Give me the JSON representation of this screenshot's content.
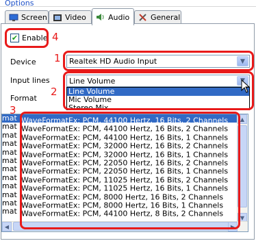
{
  "group_title": "Options",
  "tabs": [
    {
      "label": "Screen",
      "icon": "monitor-icon"
    },
    {
      "label": "Video",
      "icon": "film-icon"
    },
    {
      "label": "Audio",
      "icon": "speaker-icon",
      "active": true
    },
    {
      "label": "General",
      "icon": "tools-icon"
    }
  ],
  "enable_label": "Enable",
  "enable_checked": true,
  "device_label": "Device",
  "device_value": "Realtek HD Audio Input",
  "input_lines_label": "Input lines",
  "input_lines_value": "Line Volume",
  "input_lines_options": [
    "Line Volume",
    "Mic Volume",
    "Stereo Mix"
  ],
  "format_label": "Format",
  "callouts": {
    "n1": "1",
    "n2": "2",
    "n3": "3",
    "n4": "4"
  },
  "format_list": [
    "WaveFormatEx: PCM, 44100 Hertz, 16 Bits, 2 Channels",
    "WaveFormatEx: PCM, 44100 Hertz, 16 Bits, 2 Channels",
    "WaveFormatEx: PCM, 44100 Hertz, 16 Bits, 1 Channels",
    "WaveFormatEx: PCM, 32000 Hertz, 16 Bits, 2 Channels",
    "WaveFormatEx: PCM, 32000 Hertz, 16 Bits, 1 Channels",
    "WaveFormatEx: PCM, 22050 Hertz, 16 Bits, 2 Channels",
    "WaveFormatEx: PCM, 22050 Hertz, 16 Bits, 1 Channels",
    "WaveFormatEx: PCM, 11025 Hertz, 16 Bits, 2 Channels",
    "WaveFormatEx: PCM, 11025 Hertz, 16 Bits, 1 Channels",
    "WaveFormatEx: PCM, 8000 Hertz, 16 Bits, 2 Channels",
    "WaveFormatEx: PCM, 8000 Hertz, 16 Bits, 1 Channels",
    "WaveFormatEx: PCM, 44100 Hertz, 8 Bits, 2 Channels"
  ],
  "format_row_prefix": "mat",
  "colors": {
    "highlight": "#316ac5",
    "callout": "#e81a1a",
    "group_title": "#1f52c8"
  }
}
